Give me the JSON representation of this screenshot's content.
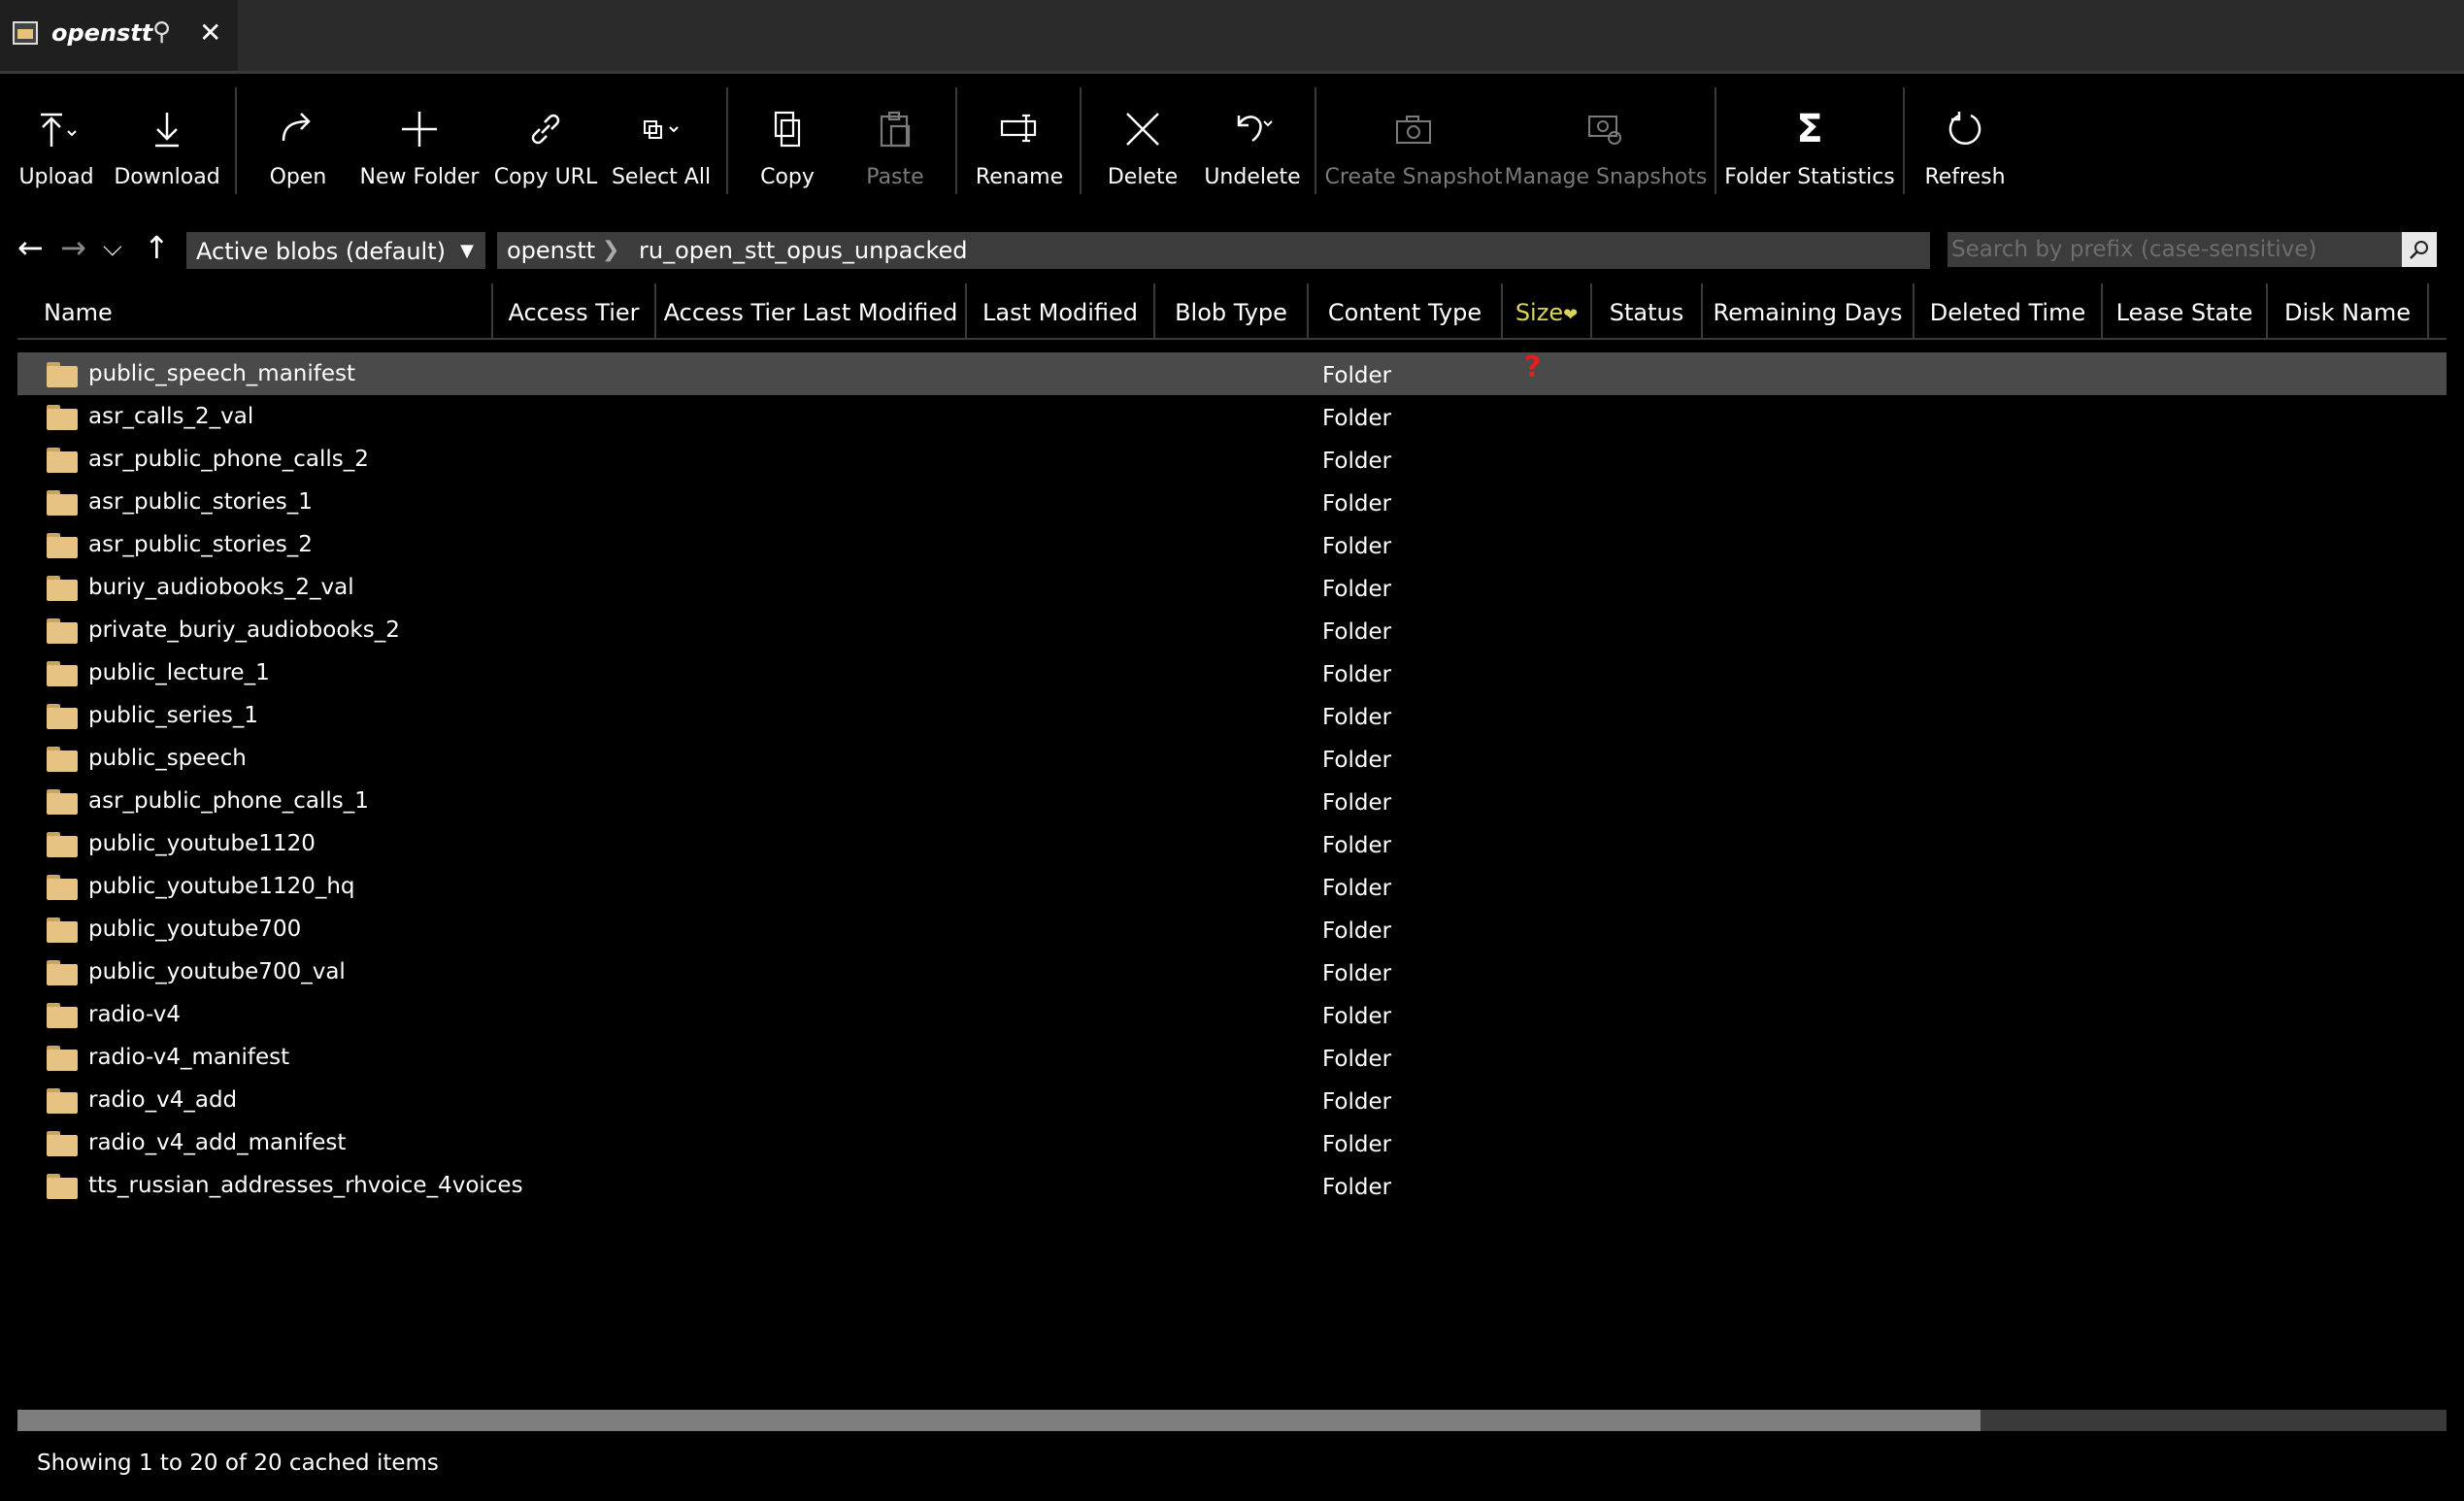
{
  "tab": {
    "title": "openstt"
  },
  "toolbar": {
    "upload": "Upload",
    "download": "Download",
    "open": "Open",
    "new_folder": "New Folder",
    "copy_url": "Copy URL",
    "select_all": "Select All",
    "copy": "Copy",
    "paste": "Paste",
    "rename": "Rename",
    "delete": "Delete",
    "undelete": "Undelete",
    "create_snapshot": "Create Snapshot",
    "manage_snapshots": "Manage Snapshots",
    "folder_statistics": "Folder Statistics",
    "refresh": "Refresh"
  },
  "nav": {
    "blob_view": "Active blobs (default)",
    "breadcrumb": [
      "openstt",
      "ru_open_stt_opus_unpacked"
    ],
    "search_placeholder": "Search by prefix (case-sensitive)"
  },
  "columns": [
    "Name",
    "Access Tier",
    "Access Tier Last Modified",
    "Last Modified",
    "Blob Type",
    "Content Type",
    "Size",
    "Status",
    "Remaining Days",
    "Deleted Time",
    "Lease State",
    "Disk Name"
  ],
  "rows": [
    {
      "name": "public_speech_manifest",
      "type": "Folder",
      "status": "?"
    },
    {
      "name": "asr_calls_2_val",
      "type": "Folder"
    },
    {
      "name": "asr_public_phone_calls_2",
      "type": "Folder"
    },
    {
      "name": "asr_public_stories_1",
      "type": "Folder"
    },
    {
      "name": "asr_public_stories_2",
      "type": "Folder"
    },
    {
      "name": "buriy_audiobooks_2_val",
      "type": "Folder"
    },
    {
      "name": "private_buriy_audiobooks_2",
      "type": "Folder"
    },
    {
      "name": "public_lecture_1",
      "type": "Folder"
    },
    {
      "name": "public_series_1",
      "type": "Folder"
    },
    {
      "name": "public_speech",
      "type": "Folder"
    },
    {
      "name": "asr_public_phone_calls_1",
      "type": "Folder"
    },
    {
      "name": "public_youtube1120",
      "type": "Folder"
    },
    {
      "name": "public_youtube1120_hq",
      "type": "Folder"
    },
    {
      "name": "public_youtube700",
      "type": "Folder"
    },
    {
      "name": "public_youtube700_val",
      "type": "Folder"
    },
    {
      "name": "radio-v4",
      "type": "Folder"
    },
    {
      "name": "radio-v4_manifest",
      "type": "Folder"
    },
    {
      "name": "radio_v4_add",
      "type": "Folder"
    },
    {
      "name": "radio_v4_add_manifest",
      "type": "Folder"
    },
    {
      "name": "tts_russian_addresses_rhvoice_4voices",
      "type": "Folder"
    }
  ],
  "status_bar": "Showing 1 to 20 of 20 cached items"
}
